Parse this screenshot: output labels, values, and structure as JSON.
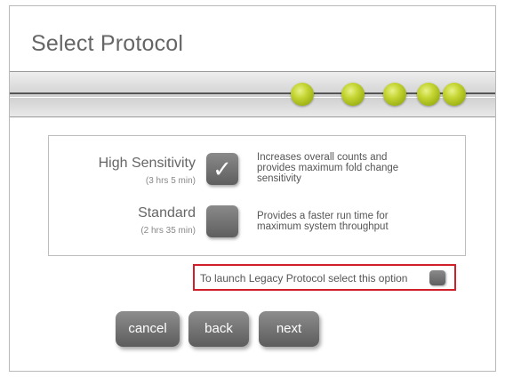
{
  "page": {
    "title": "Select Protocol"
  },
  "progress": {
    "steps": 5
  },
  "options": [
    {
      "label": "High Sensitivity",
      "time": "(3 hrs 5 min)",
      "checked": true,
      "check_glyph": "✓",
      "description": "Increases overall counts and provides maximum fold change sensitivity"
    },
    {
      "label": "Standard",
      "time": "(2 hrs 35 min)",
      "checked": false,
      "check_glyph": "",
      "description": "Provides a faster run time for maximum system throughput"
    }
  ],
  "legacy": {
    "text": "To launch Legacy Protocol select this option",
    "checked": false
  },
  "buttons": {
    "cancel": "cancel",
    "back": "back",
    "next": "next"
  },
  "colors": {
    "accent_dot": "#c5d634",
    "legacy_border": "#d01f2a",
    "button": "#6f6f6f"
  }
}
